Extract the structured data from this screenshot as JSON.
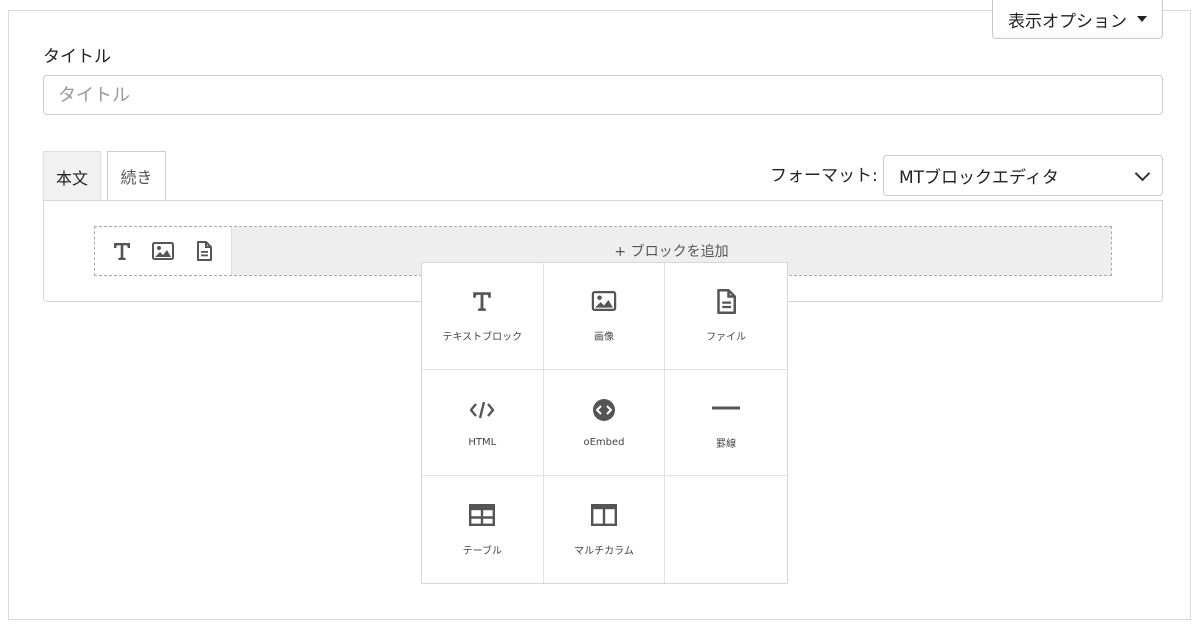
{
  "header": {
    "display_options_label": "表示オプション"
  },
  "title": {
    "label": "タイトル",
    "placeholder": "タイトル",
    "value": ""
  },
  "tabs": [
    {
      "label": "本文",
      "active": true
    },
    {
      "label": "続き",
      "active": false
    }
  ],
  "format": {
    "label": "フォーマット:",
    "selected": "MTブロックエディタ"
  },
  "editor": {
    "add_block_label": "+ ブロックを追加",
    "quick_icons": [
      "text-icon",
      "image-icon",
      "file-icon"
    ]
  },
  "block_menu": {
    "items": [
      {
        "label": "テキストブロック",
        "icon": "text-icon"
      },
      {
        "label": "画像",
        "icon": "image-icon"
      },
      {
        "label": "ファイル",
        "icon": "file-icon"
      },
      {
        "label": "HTML",
        "icon": "code-icon"
      },
      {
        "label": "oEmbed",
        "icon": "embed-icon"
      },
      {
        "label": "罫線",
        "icon": "horizontal-rule-icon"
      },
      {
        "label": "テーブル",
        "icon": "table-icon"
      },
      {
        "label": "マルチカラム",
        "icon": "columns-icon"
      }
    ]
  },
  "colors": {
    "icon": "#555555",
    "border": "#d9d9d9",
    "add_block_bg": "#eeeeee"
  }
}
